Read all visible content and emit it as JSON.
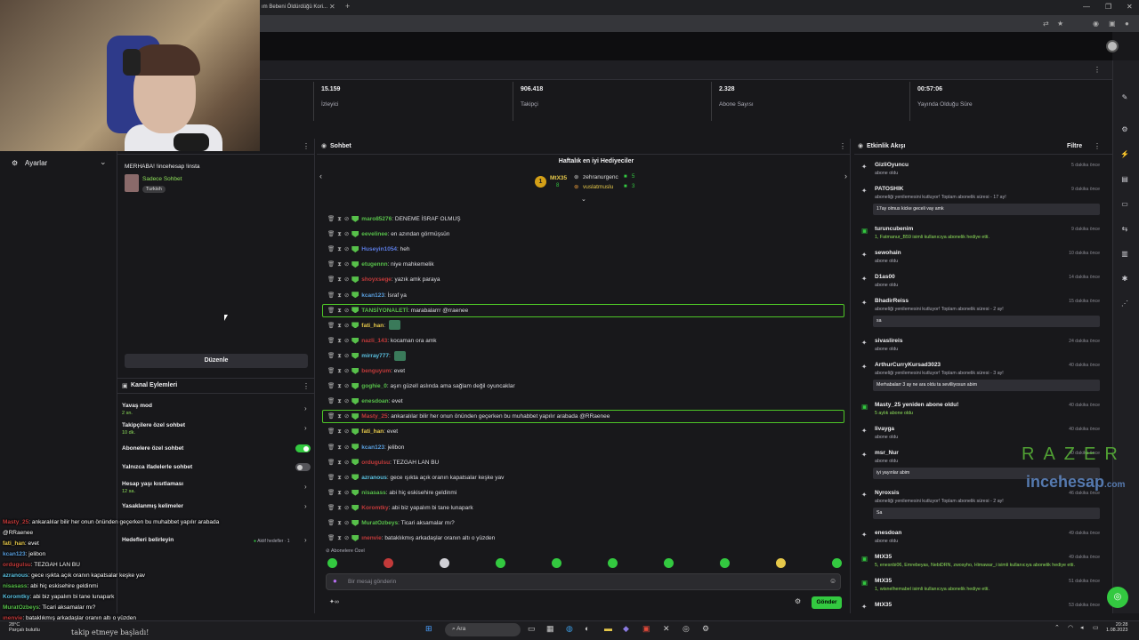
{
  "browser": {
    "tab_title": "ım Bebeni Öldürdüğü Kori..."
  },
  "stats": [
    {
      "value": "15.159",
      "label": "İzleyici"
    },
    {
      "value": "906.418",
      "label": "Takipçi"
    },
    {
      "value": "2.328",
      "label": "Abone Sayısı"
    },
    {
      "value": "00:57:06",
      "label": "Yayında Olduğu Süre"
    }
  ],
  "left": {
    "settings_label": "Ayarlar"
  },
  "pinned": {
    "welcome": "MERHABA! !incehesap !insta",
    "sub_only": "Sadece Sohbet",
    "language": "Turkish",
    "edit_label": "Düzenle"
  },
  "channel_actions": {
    "title": "Kanal Eylemleri",
    "items": [
      {
        "label": "Yavaş mod",
        "sub": "2 sn."
      },
      {
        "label": "Takipçilere özel sohbet",
        "sub": "10 dk."
      },
      {
        "label": "Abonelere özel sohbet",
        "sub": ""
      },
      {
        "label": "Yalnızca ifadelerle sohbet",
        "sub": ""
      },
      {
        "label": "Hesap yaşı kısıtlaması",
        "sub": "12 sa."
      },
      {
        "label": "Yasaklanmış kelimeler",
        "sub": ""
      },
      {
        "label": "Hedefleri belirleyin",
        "sub": ""
      }
    ],
    "goals_right": "Aktif hedefler · 1"
  },
  "overlay_chat": [
    {
      "user": "Masty_25",
      "text": ": ankaralılar bilir her onun önünden geçerken bu muhabbet yapılır arabada",
      "color": "#c23a3a"
    },
    {
      "user": "",
      "text": "@RRaenee",
      "color": "#fff"
    },
    {
      "user": "fati_han",
      "text": ": evet",
      "color": "#e6c84a"
    },
    {
      "user": "kcan123",
      "text": ": jelibon",
      "color": "#5aa0e0"
    },
    {
      "user": "ordugulsu",
      "text": ": TEZGAH LAN BU",
      "color": "#c23a3a"
    },
    {
      "user": "azranous",
      "text": ": gece ışıkta açık oranın kapatsalar keşke yav",
      "color": "#5ac0e0"
    },
    {
      "user": "nisasass",
      "text": ": abi hiç eskisehire geldinmi",
      "color": "#57c04a"
    },
    {
      "user": "Koromtky",
      "text": ": abi biz yapalım bi tane lunapark",
      "color": "#5ac0e0"
    },
    {
      "user": "MuratOzbeys",
      "text": ": Ticari aksamalar mı?",
      "color": "#57c04a"
    },
    {
      "user": "ınenvie",
      "text": ": bataklıkmış arkadaşlar oranın altı o yüzden",
      "color": "#c23a3a"
    }
  ],
  "chat": {
    "title": "Sohbet",
    "gift_title": "Haftalık en iyi Hediyeciler",
    "gift_top": {
      "rank": "1",
      "name": "MtX35",
      "count": "8"
    },
    "gift_others": [
      {
        "name": "zehranurgenc",
        "count": "5"
      },
      {
        "name": "vuslatmuslu",
        "count": "3"
      }
    ],
    "messages": [
      {
        "user": "maro85276",
        "text": ": DENEME İSRAF OLMUŞ",
        "color": "#57c04a",
        "hl": false,
        "emote": false
      },
      {
        "user": "eevelinee",
        "text": ": en azından görmüşsün",
        "color": "#57c04a",
        "hl": false,
        "emote": false
      },
      {
        "user": "Huseyin1054",
        "text": ": heh",
        "color": "#5a7ae0",
        "hl": false,
        "emote": false
      },
      {
        "user": "etugennn",
        "text": ": niye mahkemelik",
        "color": "#57c04a",
        "hl": false,
        "emote": false
      },
      {
        "user": "shoyxsege",
        "text": ": yazık amk paraya",
        "color": "#c23a3a",
        "hl": false,
        "emote": false
      },
      {
        "user": "kcan123",
        "text": ": İsraf ya",
        "color": "#5aa0e0",
        "hl": false,
        "emote": false
      },
      {
        "user": "TANSİYONALETİ",
        "text": ": marabalarrr @rraenee",
        "color": "#57c04a",
        "hl": true,
        "emote": false
      },
      {
        "user": "fati_han",
        "text": ":",
        "color": "#e6c84a",
        "hl": false,
        "emote": true
      },
      {
        "user": "nazli_143",
        "text": ": kocaman ora amk",
        "color": "#c23a3a",
        "hl": false,
        "emote": false
      },
      {
        "user": "mirray777",
        "text": ":",
        "color": "#5ac0e0",
        "hl": false,
        "emote": true
      },
      {
        "user": "benguyum",
        "text": ": evet",
        "color": "#c23a3a",
        "hl": false,
        "emote": false
      },
      {
        "user": "goghie_0",
        "text": ": aşırı güzell aslında ama sağlam değil oyuncaklar",
        "color": "#57c04a",
        "hl": false,
        "emote": false
      },
      {
        "user": "enesdoan",
        "text": ": evet",
        "color": "#57c04a",
        "hl": false,
        "emote": false
      },
      {
        "user": "Masty_25",
        "text": ": ankaralılar bilir her onun önünden geçerken bu muhabbet yapılır arabada @RRaenee",
        "color": "#c23a3a",
        "hl": true,
        "emote": false
      },
      {
        "user": "fati_han",
        "text": ": evet",
        "color": "#e6c84a",
        "hl": false,
        "emote": false
      },
      {
        "user": "kcan123",
        "text": ": jelibon",
        "color": "#5aa0e0",
        "hl": false,
        "emote": false
      },
      {
        "user": "ordugulsu",
        "text": ": TEZGAH LAN BU",
        "color": "#c23a3a",
        "hl": false,
        "emote": false
      },
      {
        "user": "azranous",
        "text": ": gece ışıkta açık oranın kapatsalar keşke yav",
        "color": "#5ac0e0",
        "hl": false,
        "emote": false
      },
      {
        "user": "nisasass",
        "text": ": abi hiç eskisehire geldinmi",
        "color": "#57c04a",
        "hl": false,
        "emote": false
      },
      {
        "user": "Koromtky",
        "text": ": abi biz yapalım bi tane lunapark",
        "color": "#c23a3a",
        "hl": false,
        "emote": false
      },
      {
        "user": "MuratOzbeys",
        "text": ": Ticari aksamalar mı?",
        "color": "#57c04a",
        "hl": false,
        "emote": false
      },
      {
        "user": "ınenvie",
        "text": ": bataklıkmış arkadaşlar oranın altı o yüzden",
        "color": "#c23a3a",
        "hl": false,
        "emote": false
      }
    ],
    "sub_only_label": "Abonelere Özel",
    "input_placeholder": "Bir mesaj gönderin",
    "send_label": "Gönder"
  },
  "activity": {
    "title": "Etkinlik Akışı",
    "filter": "Filtre",
    "events": [
      {
        "name": "GizliOyuncu",
        "sub": "abone oldu",
        "time": "5 dakika önce",
        "msg": "",
        "green": false
      },
      {
        "name": "PATOSHIK",
        "sub": "aboneliği yenilemesini kutluyor! Toplam abonelik süresi - 17 ay!",
        "time": "9 dakika önce",
        "msg": "17ay olmus kicke geceli vay amk",
        "green": false
      },
      {
        "name": "turuncubenim",
        "sub": "1, Fatmanur_B59 isimli kullanıcıya abonelik hediye etti.",
        "time": "9 dakika önce",
        "msg": "",
        "green": true
      },
      {
        "name": "sewohain",
        "sub": "abone oldu",
        "time": "10 dakika önce",
        "msg": "",
        "green": false
      },
      {
        "name": "D1as00",
        "sub": "abone oldu",
        "time": "14 dakika önce",
        "msg": "",
        "green": false
      },
      {
        "name": "BhadirReiss",
        "sub": "aboneliği yenilemesini kutluyor! Toplam abonelik süresi - 2 ay!",
        "time": "15 dakika önce",
        "msg": "sa",
        "green": false
      },
      {
        "name": "sivaslireis",
        "sub": "abone oldu",
        "time": "24 dakika önce",
        "msg": "",
        "green": false
      },
      {
        "name": "ArthurCurryKursad3023",
        "sub": "aboneliği yenilemesini kutluyor! Toplam abonelik süresi - 3 ay!",
        "time": "40 dakika önce",
        "msg": "Merhabalarr 3 ay ne ara oldu ta sevilliyosun abim",
        "green": false
      },
      {
        "name": "Masty_25 yeniden abone oldu!",
        "sub": "5 aylık abone oldu",
        "time": "40 dakika önce",
        "msg": "",
        "green": true
      },
      {
        "name": "livayga",
        "sub": "abone oldu",
        "time": "40 dakika önce",
        "msg": "",
        "green": false
      },
      {
        "name": "msr_Nur",
        "sub": "abone oldu",
        "time": "40 dakika önce",
        "msg": "iyi yayınlar abim",
        "green": false
      },
      {
        "name": "Nyroxsis",
        "sub": "aboneliği yenilemesini kutluyor! Toplam abonelik süresi - 2 ay!",
        "time": "46 dakika önce",
        "msg": "Sa",
        "green": false
      },
      {
        "name": "enesdoan",
        "sub": "abone oldu",
        "time": "49 dakika önce",
        "msg": "",
        "green": false
      },
      {
        "name": "MtX35",
        "sub": "5, enesnbi06, Emrebeyas, NebiDRN, zwosyho, Himawar_i isimli kullanıcıya abonelik hediye etti.",
        "time": "49 dakika önce",
        "msg": "",
        "green": true
      },
      {
        "name": "MtX35",
        "sub": "1, wisnelhemabel isimli kullanıcıya abonelik hediye etti.",
        "time": "51 dakika önce",
        "msg": "",
        "green": true
      },
      {
        "name": "MtX35",
        "sub": "",
        "time": "53 dakika önce",
        "msg": "",
        "green": false
      }
    ]
  },
  "watermark": {
    "razer": "RAZER",
    "incehesap": "incehesap",
    "incehesap_tld": ".com"
  },
  "taskbar": {
    "search": "Ara",
    "time": "20:28",
    "date": "1.08.2023",
    "weather_temp": "28°C",
    "weather_text": "Parçalı bulutlu"
  },
  "toast": "takip etmeye başladı!"
}
